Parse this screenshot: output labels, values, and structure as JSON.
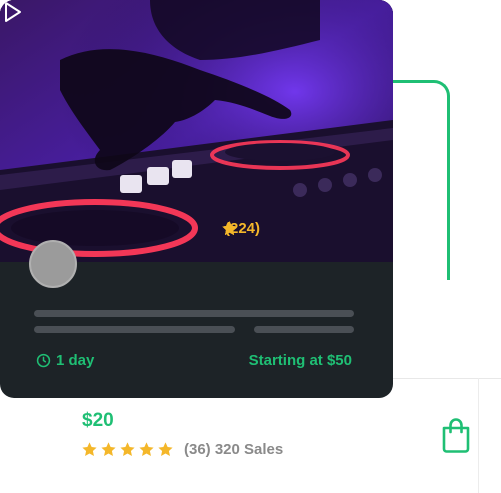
{
  "listing": {
    "rating_count": "(224)",
    "delivery": "1 day",
    "starting_price": "Starting at $50",
    "price": "$20",
    "reviews_summary": "(36) 320 Sales",
    "rating_stars": 5,
    "review_stars": 5
  },
  "icons": {
    "play": "play-icon",
    "clock": "clock-icon",
    "star": "star-icon",
    "bag": "shopping-bag-icon"
  },
  "colors": {
    "accent_green": "#1fbf74",
    "star_gold": "#f4b72a",
    "card_dark": "#1d2327",
    "avatar_gray": "#9b9b9b",
    "placeholder_line": "#4a4f55"
  }
}
